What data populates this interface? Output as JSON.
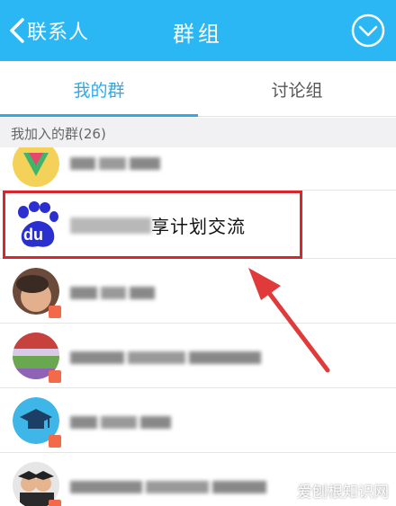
{
  "header": {
    "back_label": "联系人",
    "title": "群组"
  },
  "tabs": [
    {
      "label": "我的群",
      "active": true
    },
    {
      "label": "讨论组",
      "active": false
    }
  ],
  "section": {
    "label": "我加入的群(26)"
  },
  "groups": [
    {
      "name_visible": "",
      "blurred": true
    },
    {
      "name_visible": "享计划交流",
      "blurred": true,
      "highlighted": true
    },
    {
      "name_visible": "",
      "blurred": true
    },
    {
      "name_visible": "",
      "blurred": true
    },
    {
      "name_visible": "",
      "blurred": true
    },
    {
      "name_visible": "",
      "blurred": true
    }
  ],
  "baidu_logo_text": "du",
  "watermark": "爱刨根知识网",
  "colors": {
    "header_bg": "#2bb7f3",
    "accent": "#2ea9ea",
    "highlight": "#d8262e"
  }
}
